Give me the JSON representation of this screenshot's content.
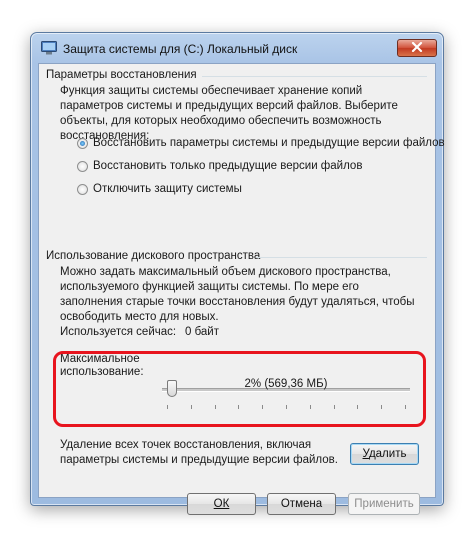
{
  "window": {
    "title": "Защита системы для (C:) Локальный диск"
  },
  "restore_settings": {
    "group_title": "Параметры восстановления",
    "description": "Функция защиты системы обеспечивает хранение копий параметров системы и предыдущих версий файлов. Выберите объекты, для которых необходимо обеспечить возможность восстановления:",
    "options": [
      {
        "label": "Восстановить параметры системы и предыдущие версии файлов",
        "checked": true
      },
      {
        "label": "Восстановить только предыдущие версии файлов",
        "checked": false
      },
      {
        "label": "Отключить защиту системы",
        "checked": false
      }
    ]
  },
  "disk_usage": {
    "group_title": "Использование дискового пространства",
    "description": "Можно задать максимальный объем дискового пространства, используемого функцией защиты системы. По мере его заполнения старые точки восстановления будут удаляться, чтобы освободить место для новых.",
    "current_label": "Используется сейчас:",
    "current_value": "0 байт",
    "max_label_line1": "Максимальное",
    "max_label_line2": "использование:",
    "slider_percent": 2,
    "slider_value_text": "2% (569,36 МБ)"
  },
  "delete": {
    "description": "Удаление всех точек восстановления, включая параметры системы и предыдущие версии файлов.",
    "button_label": "Удалить",
    "button_accel": "У"
  },
  "footer": {
    "ok_label": "ОК",
    "cancel_label": "Отмена",
    "apply_label": "Применить"
  },
  "colors": {
    "highlight": "#e8141e",
    "title_bar": "#a9c4e6",
    "client_bg": "#f0f0f0"
  },
  "icons": {
    "title": "system-protection-icon",
    "close": "close-icon"
  }
}
